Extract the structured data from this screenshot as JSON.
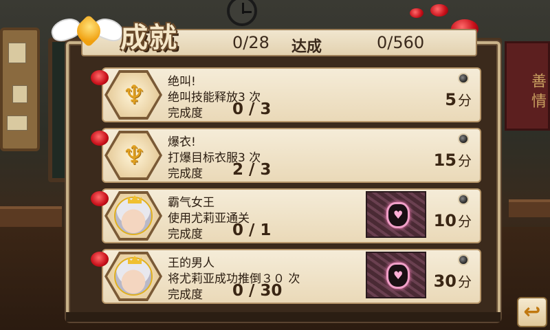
{
  "header": {
    "title": "成就",
    "progress": "0/28",
    "achieved_label": "达成",
    "score": "0/560"
  },
  "background": {
    "banner_text": "善 情"
  },
  "achievements": [
    {
      "name": "绝叫!",
      "desc": "绝叫技能释放3 次",
      "progress_label": "完成度",
      "progress": "0 / 3",
      "points": "5",
      "points_unit": "分",
      "icon": "trophy-icon",
      "locked": false
    },
    {
      "name": "爆衣!",
      "desc": "打爆目标衣服3 次",
      "progress_label": "完成度",
      "progress": "2 / 3",
      "points": "15",
      "points_unit": "分",
      "icon": "trophy-icon",
      "locked": false
    },
    {
      "name": "霸气女王",
      "desc": "使用尤莉亚通关",
      "progress_label": "完成度",
      "progress": "0 / 1",
      "points": "10",
      "points_unit": "分",
      "icon": "character-avatar",
      "locked": true
    },
    {
      "name": "王的男人",
      "desc": "将尤莉亚成功推倒３０ 次",
      "progress_label": "完成度",
      "progress": "0 / 30",
      "points": "30",
      "points_unit": "分",
      "icon": "character-avatar",
      "locked": true
    }
  ],
  "back_button": {
    "label": "↩",
    "icon": "back-arrow-icon"
  },
  "colors": {
    "card_bg": "#f5ecd8",
    "panel_border": "#c9b38a",
    "accent_red": "#c8101a",
    "trophy_gold": "#e0a020"
  }
}
